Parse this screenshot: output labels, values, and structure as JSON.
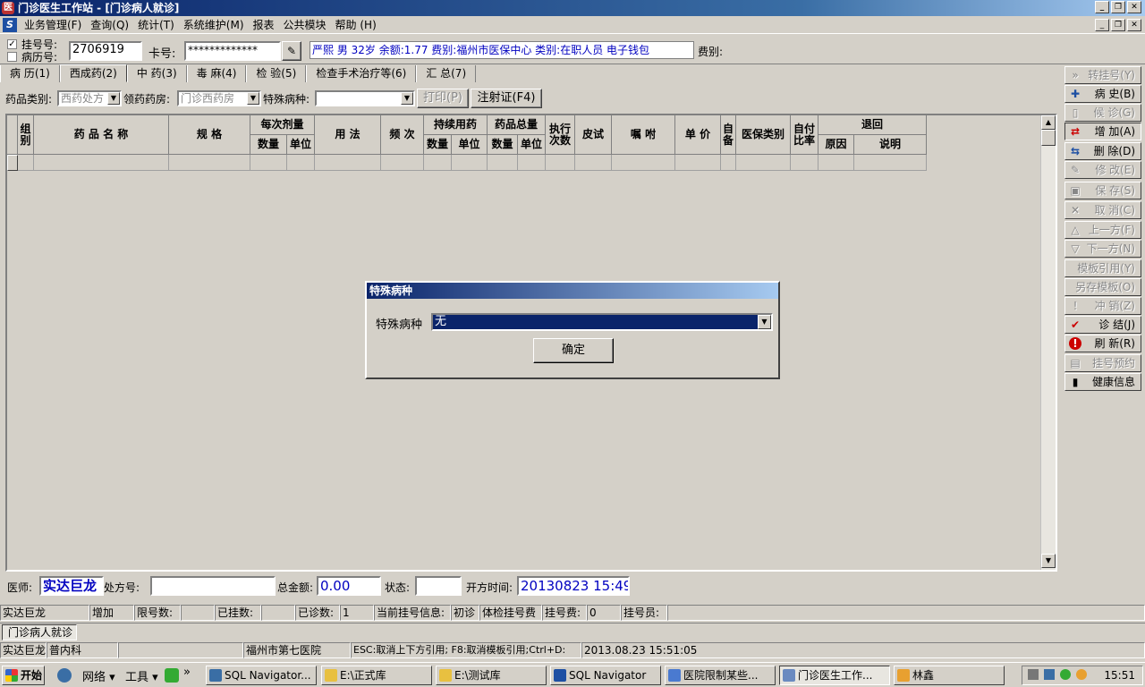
{
  "window": {
    "title": "门诊医生工作站 - [门诊病人就诊]"
  },
  "menu": {
    "items": [
      "业务管理(F)",
      "查询(Q)",
      "统计(T)",
      "系统维护(M)",
      "报表",
      "公共模块",
      "帮助 (H)"
    ]
  },
  "patient": {
    "reg_no_label": "挂号号:",
    "record_no_label": "病历号:",
    "reg_no_checked": true,
    "reg_no_value": "2706919",
    "card_label": "卡号:",
    "card_value": "*************",
    "info_text": "严熙 男 32岁 余额:1.77 费别:福州市医保中心 类别:在职人员 电子钱包",
    "fee_label": "费别:"
  },
  "tabs": [
    {
      "label": "病 历(1)",
      "active": false
    },
    {
      "label": "西成药(2)",
      "active": true
    },
    {
      "label": "中 药(3)",
      "active": false
    },
    {
      "label": "毒 麻(4)",
      "active": false
    },
    {
      "label": "检 验(5)",
      "active": false
    },
    {
      "label": "检查手术治疗等(6)",
      "active": false
    },
    {
      "label": "汇 总(7)",
      "active": false
    }
  ],
  "filter": {
    "drug_type_label": "药品类别:",
    "drug_type_value": "西药处方",
    "pharmacy_label": "领药药房:",
    "pharmacy_value": "门诊西药房",
    "special_disease_label": "特殊病种:",
    "special_disease_value": "",
    "print_button": "打印(P)",
    "injection_button": "注射证(F4)"
  },
  "grid": {
    "headers": {
      "group": "组别",
      "drug_name": "药 品 名 称",
      "spec": "规 格",
      "per_dose": "每次剂量",
      "qty": "数量",
      "unit": "单位",
      "usage": "用 法",
      "frequency": "频 次",
      "continuous": "持续用药",
      "total": "药品总量",
      "exec_times": "执行次数",
      "skin_test": "皮试",
      "instruction": "嘱 咐",
      "unit_price": "单 价",
      "self_prep": "自备",
      "insurance_type": "医保类别",
      "self_pay_ratio": "自付比率",
      "return": "退回",
      "reason": "原因",
      "note": "说明"
    }
  },
  "footer": {
    "doctor_label": "医师:",
    "doctor_value": "实达巨龙",
    "rx_no_label": "处方号:",
    "rx_no_value": "",
    "total_label": "总金额:",
    "total_value": "0.00",
    "status_label": "状态:",
    "status_value": "",
    "open_time_label": "开方时间:",
    "open_time_value": "20130823 15:49"
  },
  "right_buttons": [
    {
      "label": "转挂号(Y)",
      "icon": "arrows-icon",
      "enabled": false
    },
    {
      "label": "病 史(B)",
      "icon": "plus-icon",
      "enabled": true
    },
    {
      "label": "候 诊(G)",
      "icon": "doc-icon",
      "enabled": false
    },
    {
      "label": "增 加(A)",
      "icon": "add-icon",
      "enabled": true
    },
    {
      "label": "删 除(D)",
      "icon": "delete-icon",
      "enabled": true
    },
    {
      "label": "修 改(E)",
      "icon": "edit-icon",
      "enabled": false
    },
    {
      "label": "保 存(S)",
      "icon": "save-icon",
      "enabled": false
    },
    {
      "label": "取 消(C)",
      "icon": "cancel-icon",
      "enabled": false
    },
    {
      "label": "上一方(F)",
      "icon": "up-icon",
      "enabled": false
    },
    {
      "label": "下一方(N)",
      "icon": "down-icon",
      "enabled": false
    },
    {
      "label": "模板引用(Y)",
      "icon": "",
      "enabled": false
    },
    {
      "label": "另存模板(O)",
      "icon": "",
      "enabled": false
    },
    {
      "label": "冲 销(Z)",
      "icon": "exclaim-icon",
      "enabled": false
    },
    {
      "label": "诊 结(J)",
      "icon": "check-icon",
      "enabled": true
    },
    {
      "label": "刷 新(R)",
      "icon": "refresh-icon",
      "enabled": true
    },
    {
      "label": "挂号预约",
      "icon": "calendar-icon",
      "enabled": false
    },
    {
      "label": "健康信息",
      "icon": "door-icon",
      "enabled": true
    }
  ],
  "dialog": {
    "title": "特殊病种",
    "field_label": "特殊病种",
    "field_value": "无",
    "ok_button": "确定"
  },
  "status1": {
    "user": "实达巨龙",
    "mode": "增加",
    "limit_label": "限号数:",
    "limit_value": "",
    "registered_label": "已挂数:",
    "registered_value": "",
    "diagnosed_label": "已诊数:",
    "diagnosed_value": "1",
    "current_label": "当前挂号信息:",
    "visit_type": "初诊",
    "reg_fee_type": "体检挂号费",
    "reg_fee_label": "挂号费:",
    "reg_fee_value": "0",
    "registrar_label": "挂号员:"
  },
  "window_tab": "门诊病人就诊",
  "status2": {
    "user": "实达巨龙",
    "dept": "普内科",
    "hospital": "福州市第七医院",
    "hint": "ESC:取消上下方引用; F8:取消模板引用;Ctrl+D:",
    "datetime": "2013.08.23 15:51:05"
  },
  "taskbar": {
    "start": "开始",
    "network": "网络",
    "tools": "工具",
    "items": [
      {
        "label": "SQL Navigator...",
        "color": "#3a6ea5"
      },
      {
        "label": "E:\\正式库",
        "color": "#e8c040"
      },
      {
        "label": "E:\\测试库",
        "color": "#e8c040"
      },
      {
        "label": "SQL Navigator",
        "color": "#1d4fa3"
      },
      {
        "label": "医院限制某些...",
        "color": "#4a7ad0"
      },
      {
        "label": "门诊医生工作...",
        "color": "#6a8ac0"
      },
      {
        "label": "林鑫",
        "color": "#e8a030"
      }
    ],
    "clock": "15:51"
  }
}
